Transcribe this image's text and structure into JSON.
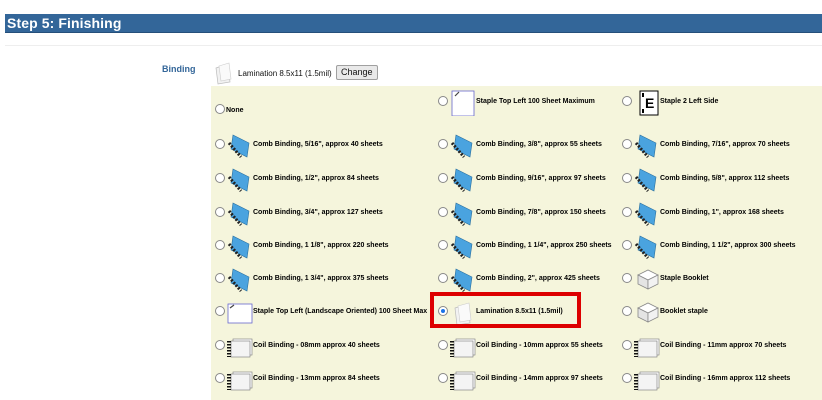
{
  "header": {
    "title": "Step 5: Finishing"
  },
  "binding": {
    "label": "Binding",
    "current_selection": "Lamination 8.5x11 (1.5mil)",
    "change_label": "Change"
  },
  "options": [
    {
      "label": "None",
      "icon": "none",
      "checked": false
    },
    {
      "label": "Staple Top Left 100 Sheet Maximum",
      "icon": "staple-top-left-icon",
      "checked": false
    },
    {
      "label": "Staple 2 Left Side",
      "icon": "staple-2-left-icon",
      "checked": false
    },
    {
      "label": "Comb Binding, 5/16\", approx 40 sheets",
      "icon": "comb-binding-icon",
      "checked": false
    },
    {
      "label": "Comb Binding, 3/8\", approx 55 sheets",
      "icon": "comb-binding-icon",
      "checked": false
    },
    {
      "label": "Comb Binding, 7/16\", approx 70 sheets",
      "icon": "comb-binding-icon",
      "checked": false
    },
    {
      "label": "Comb Binding, 1/2\", approx 84 sheets",
      "icon": "comb-binding-icon",
      "checked": false
    },
    {
      "label": "Comb Binding, 9/16\", approx 97 sheets",
      "icon": "comb-binding-icon",
      "checked": false
    },
    {
      "label": "Comb Binding, 5/8\", approx 112 sheets",
      "icon": "comb-binding-icon",
      "checked": false
    },
    {
      "label": "Comb Binding, 3/4\", approx 127 sheets",
      "icon": "comb-binding-icon",
      "checked": false
    },
    {
      "label": "Comb Binding, 7/8\", approx 150 sheets",
      "icon": "comb-binding-icon",
      "checked": false
    },
    {
      "label": "Comb Binding, 1\", approx 168 sheets",
      "icon": "comb-binding-icon",
      "checked": false
    },
    {
      "label": "Comb Binding, 1 1/8\", approx 220 sheets",
      "icon": "comb-binding-icon",
      "checked": false
    },
    {
      "label": "Comb Binding, 1 1/4\", approx 250 sheets",
      "icon": "comb-binding-icon",
      "checked": false
    },
    {
      "label": "Comb Binding, 1 1/2\", approx 300 sheets",
      "icon": "comb-binding-icon",
      "checked": false
    },
    {
      "label": "Comb Binding, 1 3/4\", approx 375 sheets",
      "icon": "comb-binding-icon",
      "checked": false
    },
    {
      "label": "Comb Binding, 2\", approx 425 sheets",
      "icon": "comb-binding-icon",
      "checked": false
    },
    {
      "label": "Staple Booklet",
      "icon": "staple-booklet-icon",
      "checked": false
    },
    {
      "label": "Staple Top Left (Landscape Oriented) 100 Sheet Max",
      "icon": "staple-landscape-icon",
      "checked": false
    },
    {
      "label": "Lamination 8.5x11 (1.5mil)",
      "icon": "lamination-icon",
      "checked": true
    },
    {
      "label": "Booklet staple",
      "icon": "booklet-staple-icon",
      "checked": false
    },
    {
      "label": "Coil Binding - 08mm approx 40 sheets",
      "icon": "coil-binding-icon",
      "checked": false
    },
    {
      "label": "Coil Binding - 10mm approx 55 sheets",
      "icon": "coil-binding-icon",
      "checked": false
    },
    {
      "label": "Coil Binding - 11mm approx 70 sheets",
      "icon": "coil-binding-icon",
      "checked": false
    },
    {
      "label": "Coil Binding - 13mm approx 84 sheets",
      "icon": "coil-binding-icon",
      "checked": false
    },
    {
      "label": "Coil Binding - 14mm approx 97 sheets",
      "icon": "coil-binding-icon",
      "checked": false
    },
    {
      "label": "Coil Binding - 16mm approx 112 sheets",
      "icon": "coil-binding-icon",
      "checked": false
    }
  ],
  "colors": {
    "header_bg": "#336699",
    "panel_bg": "#f5f5dc",
    "highlight": "#dd0000",
    "label_blue": "#336699"
  }
}
